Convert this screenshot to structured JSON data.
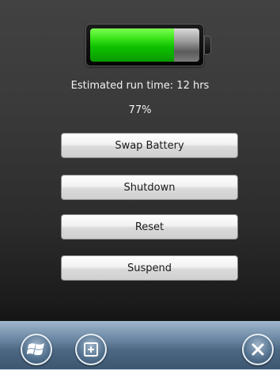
{
  "battery": {
    "level": 0.77,
    "fill_color": "#1ec900",
    "estimated_runtime": "Estimated run time: 12 hrs",
    "percent_label": "77%"
  },
  "actions": [
    {
      "label": "Swap Battery"
    },
    {
      "label": "Shutdown"
    },
    {
      "label": "Reset"
    },
    {
      "label": "Suspend"
    }
  ],
  "taskbar": {
    "start_icon": "windows-flag-icon",
    "center_icon": "input-panel-icon",
    "close_icon": "close-icon"
  }
}
